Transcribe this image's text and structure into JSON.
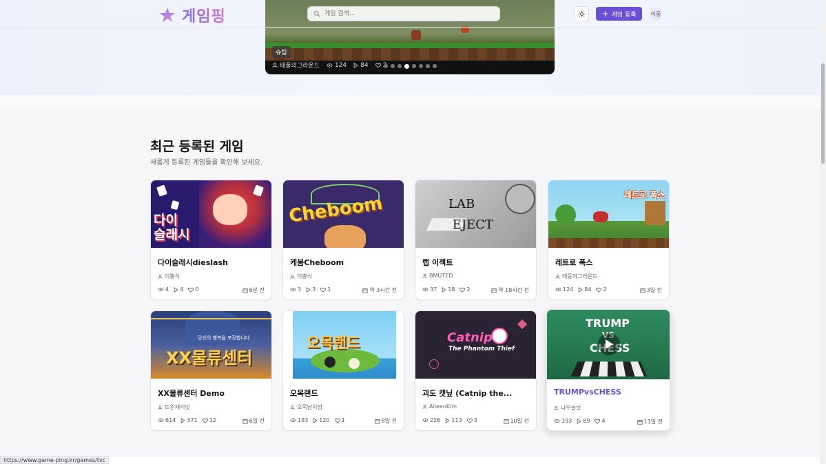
{
  "header": {
    "logo_text": "게임핑",
    "search_placeholder": "게임 검색...",
    "register_label": "게임 등록",
    "avatar_label": "이룽"
  },
  "hero": {
    "tag": "슈팅",
    "author": "태풍의그라운드",
    "views": "124",
    "plays": "84",
    "likes": "2",
    "slide_count": 8,
    "active_slide": 4
  },
  "section": {
    "title": "최근 등록된 게임",
    "subtitle": "새롭게 등록된 게임들을 확인해 보세요."
  },
  "games": [
    {
      "title": "다이슬래시dieslash",
      "author": "이뿡식",
      "views": "4",
      "plays": "4",
      "likes": "0",
      "date": "6분 전",
      "thumb_text": "다이\n슬래시"
    },
    {
      "title": "케붐Cheboom",
      "author": "이뿡식",
      "views": "3",
      "plays": "3",
      "likes": "1",
      "date": "약 3시간 전",
      "thumb_text": "Cheboom"
    },
    {
      "title": "랩 이젝트",
      "author": "BMUTED",
      "views": "37",
      "plays": "18",
      "likes": "2",
      "date": "약 18시간 전",
      "thumb_text": "LAB EJECT"
    },
    {
      "title": "레트로 폭스",
      "author": "태풍의그라운드",
      "views": "124",
      "plays": "84",
      "likes": "2",
      "date": "3일 전",
      "thumb_text": "레트로 폭스"
    },
    {
      "title": "XX물류센터 Demo",
      "author": "트윈채리엇",
      "views": "614",
      "plays": "371",
      "likes": "12",
      "date": "6일 전",
      "thumb_text": "XX물류센터"
    },
    {
      "title": "오목랜드",
      "author": "오목납치범",
      "views": "183",
      "plays": "120",
      "likes": "1",
      "date": "8일 전",
      "thumb_text": "오목랜드"
    },
    {
      "title": "괴도 캣닢 (Catnip the...",
      "author": "AileenKim",
      "views": "226",
      "plays": "113",
      "likes": "3",
      "date": "10일 전",
      "thumb_text": "Catnip"
    },
    {
      "title": "TRUMPvsCHESS",
      "author": "나무늘보",
      "views": "193",
      "plays": "89",
      "likes": "4",
      "date": "11일 전",
      "thumb_text": "TRUMP vs CHESS"
    }
  ],
  "status_bar": {
    "url": "https://www.game-ping.kr/games/tvc"
  },
  "colors": {
    "accent": "#6a4fd6",
    "logo_gradient_start": "#7a6df0",
    "logo_gradient_end": "#d277c9"
  }
}
